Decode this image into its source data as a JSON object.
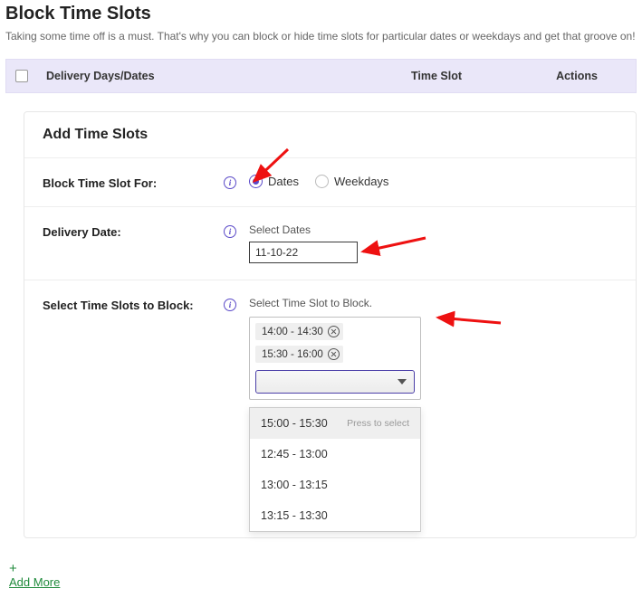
{
  "page": {
    "title": "Block Time Slots",
    "subtitle": "Taking some time off is a must. That's why you can block or hide time slots for particular dates or weekdays and get that groove on!"
  },
  "table_head": {
    "days": "Delivery Days/Dates",
    "slot": "Time Slot",
    "actions": "Actions"
  },
  "card": {
    "title": "Add Time Slots",
    "block_for_label": "Block Time Slot For:",
    "radio_dates": "Dates",
    "radio_weekdays": "Weekdays",
    "delivery_date_label": "Delivery Date:",
    "select_dates_label": "Select Dates",
    "date_value": "11-10-22",
    "select_slots_label": "Select Time Slots to Block:",
    "select_slot_hint": "Select Time Slot to Block.",
    "tags": [
      "14:00 - 14:30",
      "15:30 - 16:00"
    ],
    "dropdown": {
      "highlight": "15:00 - 15:30",
      "press_hint": "Press to select",
      "options": [
        "12:45 - 13:00",
        "13:00 - 13:15",
        "13:15 - 13:30"
      ]
    }
  },
  "add_more": "Add More"
}
